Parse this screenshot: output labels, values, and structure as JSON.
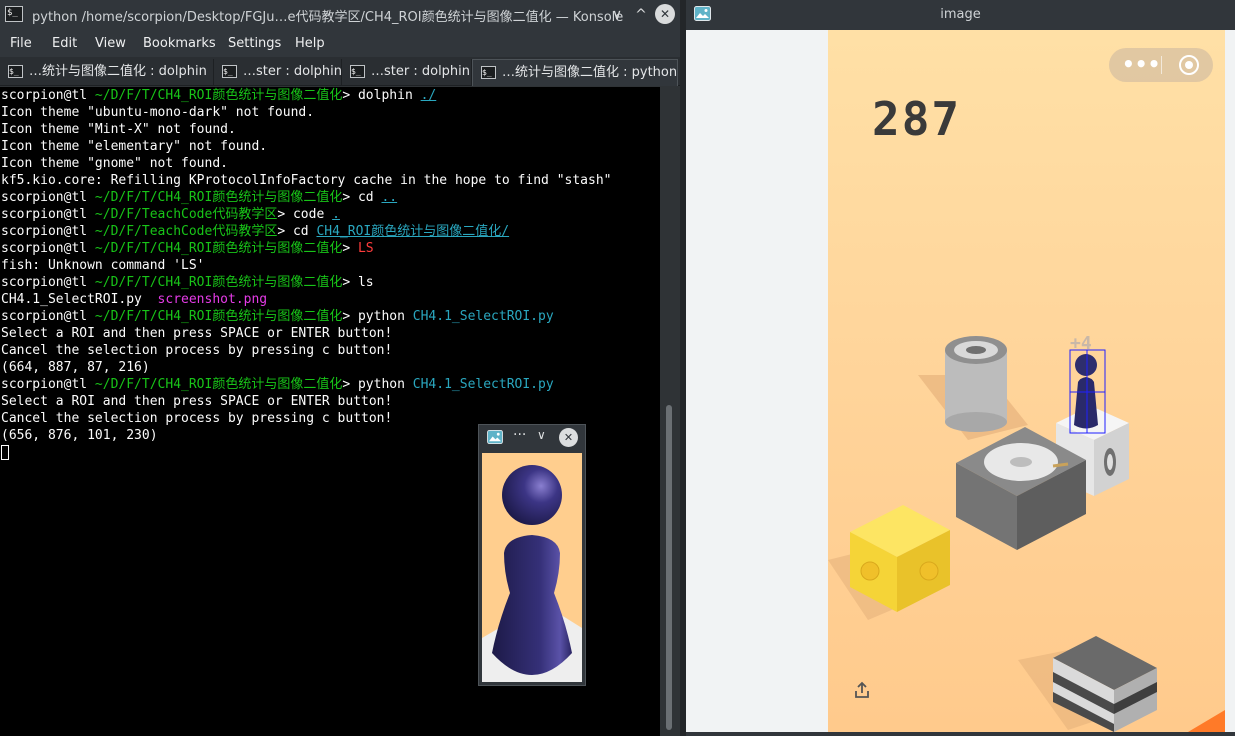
{
  "konsole": {
    "title": "python /home/scorpion/Desktop/FGJu…e代码教学区/CH4_ROI颜色统计与图像二值化 — Konsole",
    "app_icon_text": "$_",
    "buttons": {
      "minimize": "∨",
      "maximize": "^",
      "close": "✕"
    },
    "menu": [
      "File",
      "Edit",
      "View",
      "Bookmarks",
      "Settings",
      "Help"
    ],
    "tabs": [
      {
        "label": "…统计与图像二值化 : dolphin",
        "active": false
      },
      {
        "label": "…ster : dolphin",
        "active": false
      },
      {
        "label": "…ster : dolphin",
        "active": false
      },
      {
        "label": "…统计与图像二值化 : python",
        "active": true
      }
    ],
    "prompt_user": "scorpion@tl",
    "path_roi": "~/D/F/T/CH4_ROI颜色统计与图像二值化",
    "path_teach": "~/D/F/TeachCode代码教学区",
    "lines": {
      "l1_cmd": "dolphin",
      "l1_arg": "./",
      "l2": "Icon theme \"ubuntu-mono-dark\" not found.",
      "l3": "Icon theme \"Mint-X\" not found.",
      "l4": "Icon theme \"elementary\" not found.",
      "l5": "Icon theme \"gnome\" not found.",
      "l6": "kf5.kio.core: Refilling KProtocolInfoFactory cache in the hope to find \"stash\"",
      "l7_cmd": "cd",
      "l7_arg": "..",
      "l8_cmd": "code",
      "l8_arg": ".",
      "l9_cmd": "cd",
      "l9_arg": "CH4_ROI颜色统计与图像二值化/",
      "l10_cmd": "LS",
      "l11": "fish: Unknown command 'LS'",
      "l12_cmd": "ls",
      "l13_file1": "CH4.1_SelectROI.py",
      "l13_file2": "screenshot.png",
      "l14_cmd": "python",
      "l14_arg": "CH4.1_SelectROI.py",
      "l15": "Select a ROI and then press SPACE or ENTER button!",
      "l16": "Cancel the selection process by pressing c button!",
      "l17": "(664, 887, 87, 216)",
      "l18_cmd": "python",
      "l18_arg": "CH4.1_SelectROI.py",
      "l19": "Select a ROI and then press SPACE or ENTER button!",
      "l20": "Cancel the selection process by pressing c button!",
      "l21": "(656, 876, 101, 230)"
    }
  },
  "image_window": {
    "title": "image",
    "score": "287",
    "bonus": "+4",
    "pill_dots": "•••"
  },
  "roi_window": {
    "dots": "···",
    "chevron": "∨",
    "close": "✕"
  },
  "colors": {
    "prompt_green": "#18c418",
    "path_cyan": "#2aa7bf",
    "error_red": "#ff3c3c",
    "file_magenta": "#e43be6",
    "game_bg": "#ffd49a",
    "piece_blue": "#2a2a6a"
  }
}
